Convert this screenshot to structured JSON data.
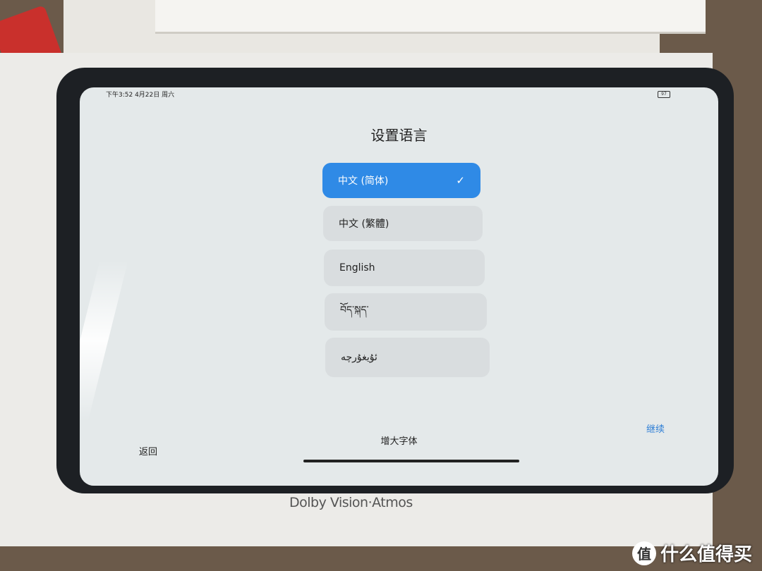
{
  "status_bar": {
    "time": "下午3:52 4月22日 周六",
    "battery": "97"
  },
  "title": "设置语言",
  "languages": [
    {
      "label": "中文 (简体)",
      "selected": true
    },
    {
      "label": "中文 (繁體)",
      "selected": false
    },
    {
      "label": "English",
      "selected": false
    },
    {
      "label": "བོད་སྐད་",
      "selected": false
    },
    {
      "label": "ئۇيغۇرچە",
      "selected": false
    }
  ],
  "check_icon": "✓",
  "footer": {
    "back": "返回",
    "larger_font": "增大字体",
    "continue": "继续"
  },
  "packaging": {
    "brand": "Dolby Vision·Atmos"
  },
  "watermark": {
    "text": "什么值得买",
    "icon": "值"
  },
  "colors": {
    "accent": "#2f8ae6",
    "link": "#2f7fd6"
  }
}
